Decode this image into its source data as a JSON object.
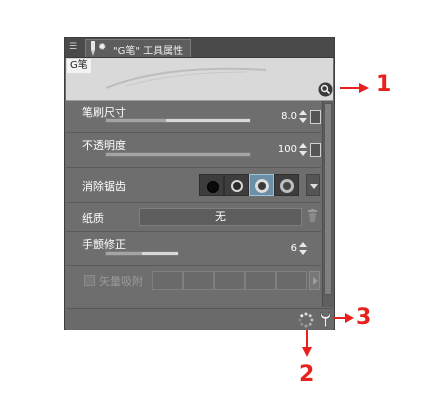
{
  "window": {
    "tab_title": "\"G笔\" 工具属性",
    "menu_icon": "menu-lines-icon",
    "tool_icon": "pen-icon",
    "settings_icon": "gear-icon"
  },
  "preview": {
    "label": "G笔",
    "magnify_icon": "magnifier-icon"
  },
  "properties": {
    "brush_size": {
      "label": "笔刷尺寸",
      "value": "8.0",
      "level": 0.42
    },
    "opacity": {
      "label": "不透明度",
      "value": "100",
      "level": 1.0
    },
    "antialias": {
      "label": "消除锯齿",
      "options_count_label": "",
      "selected_index": 2
    },
    "paper": {
      "label": "纸质",
      "value": "无"
    },
    "stabilizer": {
      "label": "手颤修正",
      "value": "6",
      "level": 0.5
    },
    "vector_snap": {
      "label": "矢量吸附",
      "checked": false
    }
  },
  "footer": {
    "reset_icon": "loading-dots-icon",
    "wrench_icon": "wrench-icon"
  },
  "annotations": {
    "one": "1",
    "two": "2",
    "three": "3"
  },
  "colors": {
    "accent_red": "#e8211c",
    "panel_bg": "#6b6b6b",
    "selected": "#6a8fa6"
  }
}
